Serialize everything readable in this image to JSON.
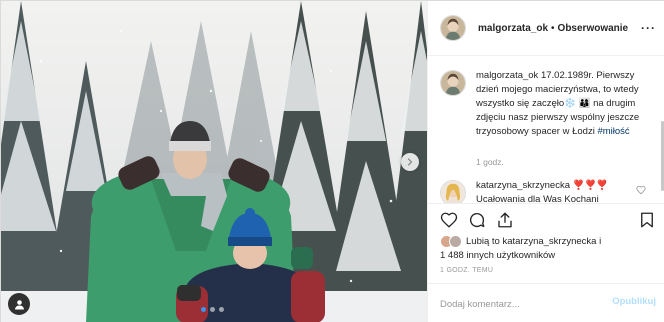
{
  "header": {
    "username": "malgorzata_ok",
    "separator": "•",
    "follow_label": "Obserwowanie",
    "more_label": "···",
    "avatar_icon": "profile-avatar"
  },
  "caption": {
    "username": "malgorzata_ok",
    "text_main": " 17.02.1989r. Pierwszy dzień mojego macierzyństwa, to wtedy wszystko się zaczęło❄️ 👨‍👩‍👦 na drugim zdjęciu nasz pierwszy wspólny jeszcze trzyosobowy spacer w Łodzi ",
    "hashtag": "#miłość",
    "time": "1 godz."
  },
  "comments": [
    {
      "username": "katarzyna_skrzynecka",
      "emojis": " ❣️❣️❣️",
      "text": "Ucałowania dla Was Kochani"
    }
  ],
  "actions": {
    "like_icon": "heart-icon",
    "comment_icon": "comment-icon",
    "share_icon": "share-icon",
    "save_icon": "bookmark-icon"
  },
  "likes": {
    "prefix": "Lubią to ",
    "user": "katarzyna_skrzynecka",
    "and": " i",
    "others": "1 488 innych użytkowników"
  },
  "timestamp": "1 GODZ. TEMU",
  "comment_box": {
    "placeholder": "Dodaj komentarz...",
    "post_label": "Opublikuj"
  },
  "carousel": {
    "total_slides": 3,
    "active_slide": 1
  },
  "colors": {
    "accent_blue": "#3897f0",
    "hashtag": "#003569",
    "muted": "#999999",
    "post_disabled": "#b2dffc",
    "jacket_green": "#3e9d6c"
  }
}
